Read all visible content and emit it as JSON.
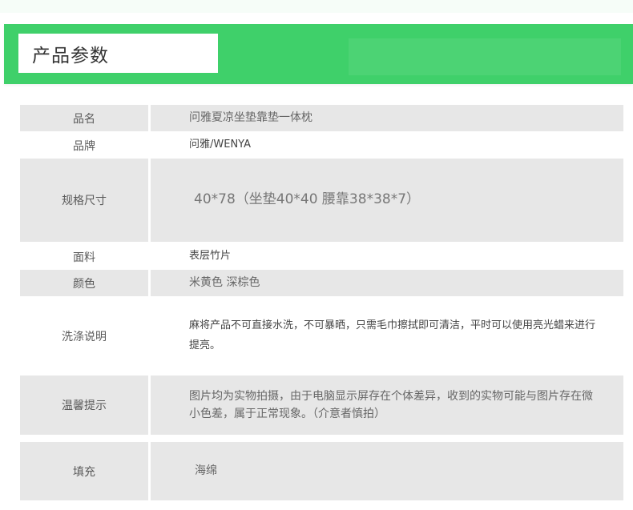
{
  "header": {
    "title": "产品参数"
  },
  "rows": [
    {
      "label": "品名",
      "value": "问雅夏凉坐垫靠垫一体枕"
    },
    {
      "label": "品牌",
      "value": "问雅/WENYA"
    },
    {
      "label": "规格尺寸",
      "value": "40*78（坐垫40*40 腰靠38*38*7）"
    },
    {
      "label": "面料",
      "value": "表层竹片"
    },
    {
      "label": "颜色",
      "value": "米黄色  深棕色"
    },
    {
      "label": "洗涤说明",
      "value": "麻将产品不可直接水洗，不可暴晒，只需毛巾擦拭即可清洁，平时可以使用亮光蜡来进行提亮。"
    },
    {
      "label": "温馨提示",
      "value": "图片均为实物拍摄，由于电脑显示屏存在个体差异，收到的实物可能与图片存在微小色差，属于正常现象。（介意者慎拍）"
    },
    {
      "label": "填充",
      "value": "海绵"
    }
  ]
}
